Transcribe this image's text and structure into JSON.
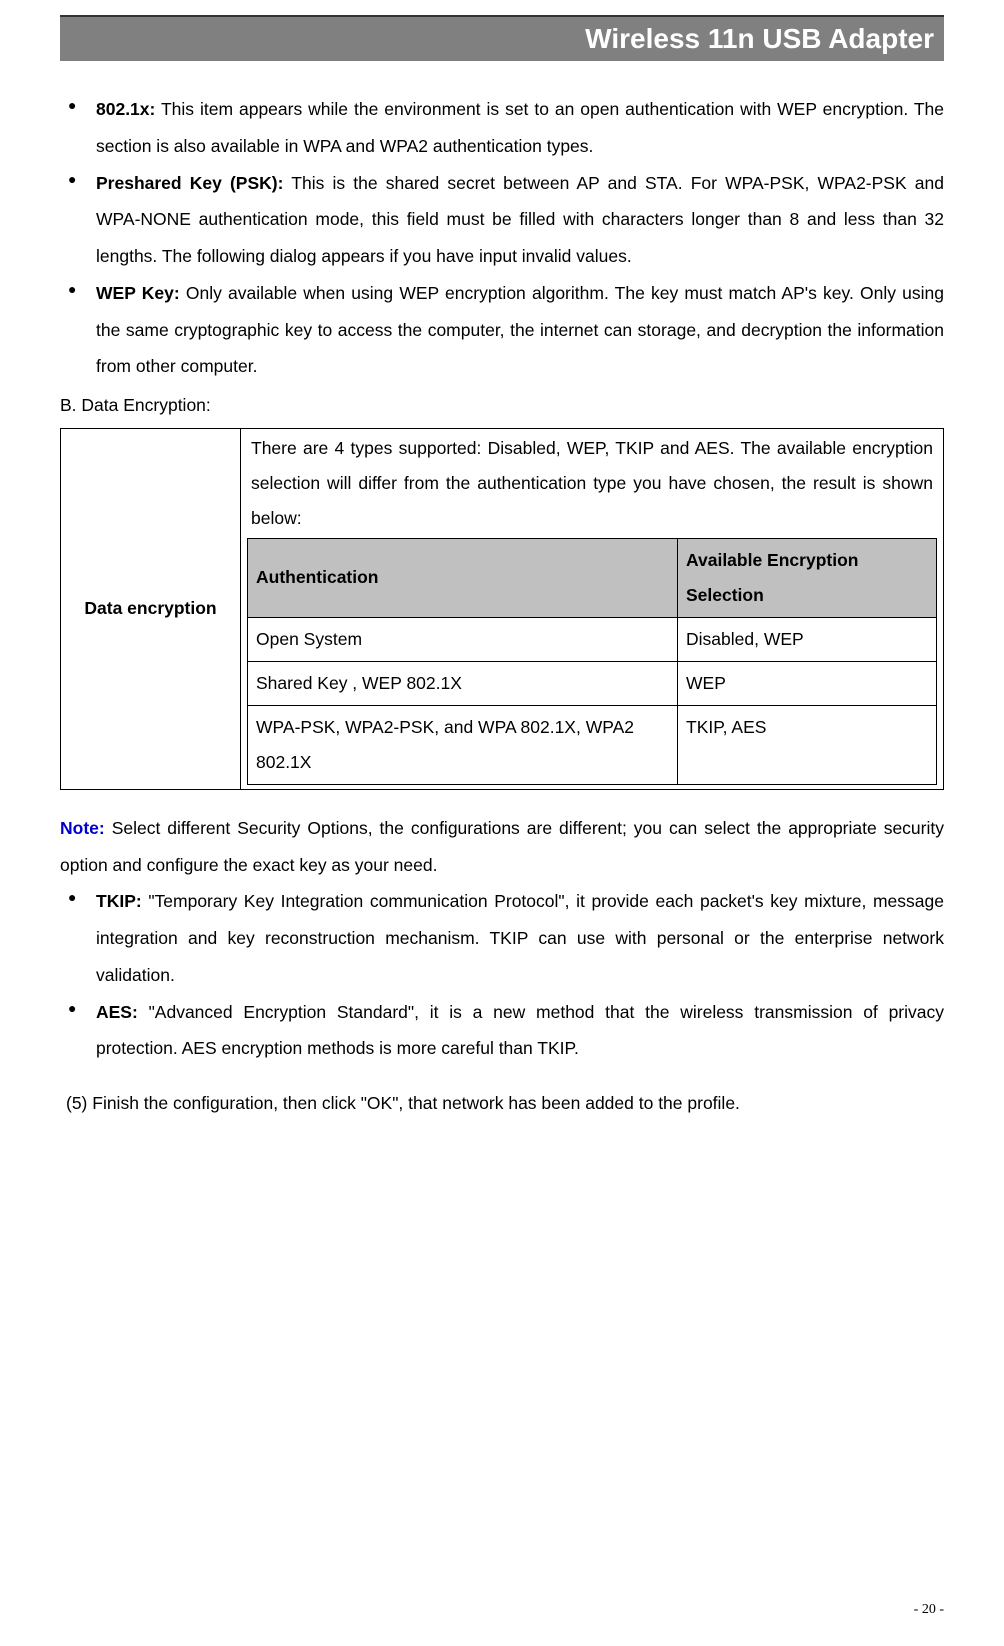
{
  "header": {
    "title": "Wireless 11n USB Adapter"
  },
  "bullets1": {
    "item1": {
      "label": "802.1x:",
      "text": " This item appears while the environment is set to an open authentication with WEP encryption. The section is also available in WPA and WPA2 authentication types."
    },
    "item2": {
      "label": "Preshared Key (PSK):",
      "text": " This is the shared secret between AP and STA. For WPA-PSK, WPA2-PSK and WPA-NONE authentication mode, this field must be filled with characters longer than 8 and less than 32 lengths. The following dialog appears if you have input invalid values."
    },
    "item3": {
      "label": "WEP Key:",
      "text": " Only available when using WEP encryption algorithm. The key must match AP's key. Only using the same cryptographic key to access the computer, the internet can storage, and decryption the information from other computer."
    }
  },
  "section_b": {
    "heading": "B. Data Encryption:",
    "label": "Data encryption",
    "description": "There are 4 types supported: Disabled, WEP, TKIP and AES. The available encryption selection will differ from the authentication type you have chosen, the result is shown below:",
    "table": {
      "header1": "Authentication",
      "header2": "Available Encryption Selection",
      "row1": {
        "auth": "Open System",
        "enc": "Disabled, WEP"
      },
      "row2": {
        "auth": "Shared Key , WEP 802.1X",
        "enc": "WEP"
      },
      "row3": {
        "auth": "WPA-PSK, WPA2-PSK, and WPA 802.1X, WPA2 802.1X",
        "enc": "TKIP, AES"
      }
    }
  },
  "note": {
    "label": "Note:",
    "text": " Select different Security Options, the configurations are different; you can select the appropriate security option and configure the exact key as your need."
  },
  "bullets2": {
    "item1": {
      "label": "TKIP:",
      "text": " \"Temporary Key Integration communication Protocol\", it provide each packet's key mixture, message integration and key reconstruction mechanism. TKIP can use with personal or the enterprise network validation."
    },
    "item2": {
      "label": "AES:",
      "text": " \"Advanced Encryption Standard\", it is a new method that the wireless transmission of privacy protection. AES encryption methods is more careful than TKIP."
    }
  },
  "finish": "(5) Finish the configuration, then click \"OK\", that network has been added to the profile.",
  "page_number": "- 20 -"
}
